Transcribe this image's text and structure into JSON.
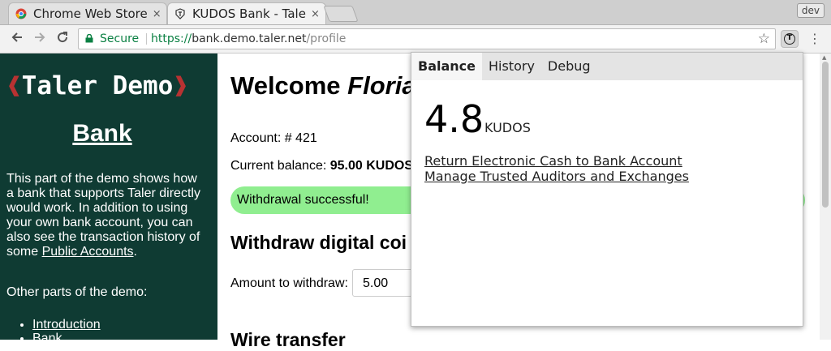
{
  "browser": {
    "tabs": [
      {
        "title": "Chrome Web Store",
        "close": "×"
      },
      {
        "title": "KUDOS Bank - Tale",
        "close": "×"
      }
    ],
    "dev_badge": "dev",
    "omnibox": {
      "secure_label": "Secure",
      "url_scheme": "https://",
      "url_host": "bank.demo.taler.net",
      "url_path": "/profile"
    },
    "icons": {
      "back": "arrow-left",
      "forward": "arrow-right",
      "reload": "reload",
      "star": "star",
      "extension": "taler-wallet",
      "menu": "vertical-dots"
    }
  },
  "sidebar": {
    "logo_left": "❰",
    "logo_text": "Taler Demo",
    "logo_right": "❱",
    "title": "Bank",
    "intro_text": "This part of the demo shows how a bank that supports Taler directly would work. In addition to using your own bank account, you can also see the transaction history of some ",
    "intro_link": "Public Accounts",
    "intro_end": ".",
    "other_parts": "Other parts of the demo:",
    "links": [
      "Introduction",
      "Bank"
    ]
  },
  "main": {
    "welcome_prefix": "Welcome ",
    "welcome_name": "Floria",
    "account": "Account: # 421",
    "balance_label": "Current balance: ",
    "balance_value": "95.00 KUDOS",
    "success": "Withdrawal successful!",
    "withdraw_heading": "Withdraw digital coi",
    "amount_label": "Amount to withdraw:",
    "amount_value": "5.00",
    "wire_heading": "Wire transfer"
  },
  "wallet": {
    "tabs": [
      "Balance",
      "History",
      "Debug"
    ],
    "active_tab": "Balance",
    "balance_amount": "4.8",
    "balance_currency": "KUDOS",
    "links": [
      "Return Electronic Cash to Bank Account",
      "Manage Trusted Auditors and Exchanges"
    ]
  },
  "colors": {
    "sidebar_bg": "#0f3b33",
    "logo_bracket": "#b83232",
    "success_bg": "#90ee90",
    "secure_green": "#0b8043"
  }
}
